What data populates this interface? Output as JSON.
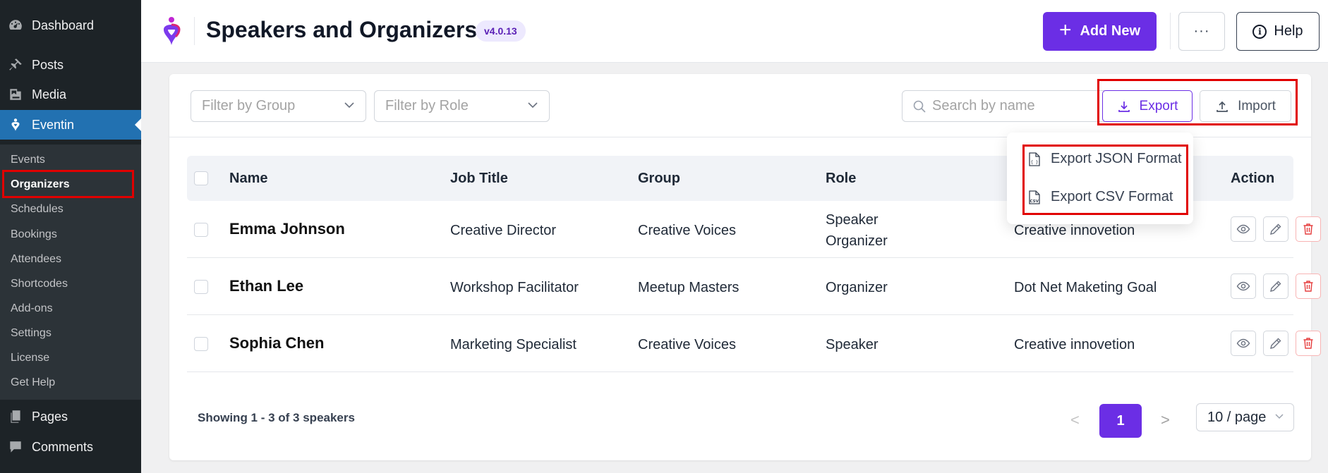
{
  "sidebar": {
    "top_items": [
      {
        "label": "Dashboard",
        "icon": "dashboard-icon"
      },
      {
        "label": "Posts",
        "icon": "pin-icon"
      },
      {
        "label": "Media",
        "icon": "media-icon"
      },
      {
        "label": "Eventin",
        "icon": "eventin-icon"
      }
    ],
    "sub_items": [
      "Events",
      "Organizers",
      "Schedules",
      "Bookings",
      "Attendees",
      "Shortcodes",
      "Add-ons",
      "Settings",
      "License",
      "Get Help"
    ],
    "bottom_items": [
      {
        "label": "Pages",
        "icon": "pages-icon"
      },
      {
        "label": "Comments",
        "icon": "comment-icon"
      }
    ],
    "active_item": "Eventin",
    "active_sub_item": "Organizers"
  },
  "header": {
    "title": "Speakers and Organizers",
    "version": "v4.0.13",
    "add_new_label": "Add New",
    "more_label": "···",
    "help_label": "Help"
  },
  "toolbar": {
    "filter_group_placeholder": "Filter by Group",
    "filter_role_placeholder": "Filter by Role",
    "search_placeholder": "Search by name",
    "export_label": "Export",
    "import_label": "Import"
  },
  "export_menu": {
    "items": [
      "Export JSON Format",
      "Export CSV Format"
    ]
  },
  "table": {
    "columns": [
      "Name",
      "Job Title",
      "Group",
      "Role",
      "Action"
    ],
    "rows": [
      {
        "name": "Emma Johnson",
        "job_title": "Creative Director",
        "group": "Creative Voices",
        "roles": [
          "Speaker",
          "Organizer"
        ],
        "company": "Creative innovetion"
      },
      {
        "name": "Ethan Lee",
        "job_title": "Workshop Facilitator",
        "group": "Meetup Masters",
        "roles": [
          "Organizer"
        ],
        "company": "Dot Net Maketing Goal"
      },
      {
        "name": "Sophia Chen",
        "job_title": "Marketing Specialist",
        "group": "Creative Voices",
        "roles": [
          "Speaker"
        ],
        "company": "Creative innovetion"
      }
    ]
  },
  "footer": {
    "showing": "Showing 1 - 3 of 3 speakers",
    "current_page": "1",
    "prev": "<",
    "next": ">",
    "page_size": "10 / page"
  },
  "colors": {
    "accent": "#6b2ee5",
    "wp_sidebar": "#1d2327",
    "wp_active": "#2271b1",
    "highlight": "#e10000",
    "danger": "#e53e3e"
  }
}
